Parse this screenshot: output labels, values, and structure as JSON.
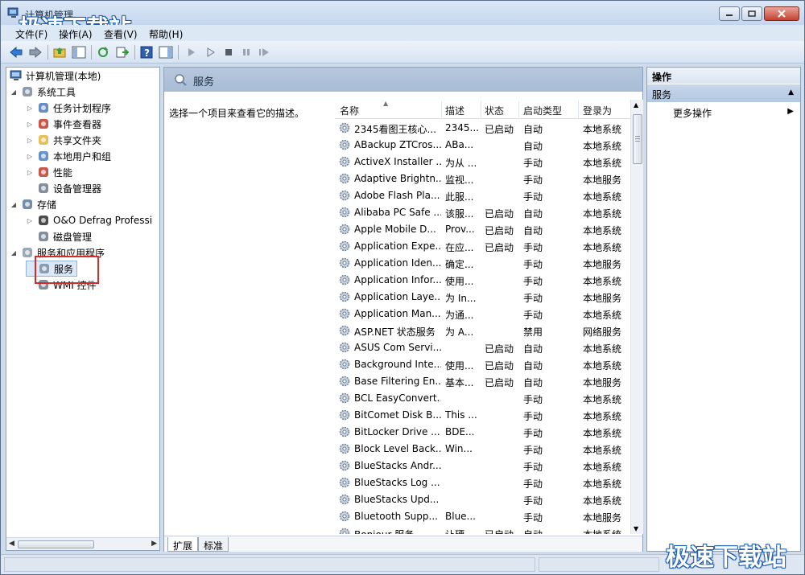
{
  "window": {
    "title": "计算机管理",
    "watermark": "极速下载站"
  },
  "menu": [
    "文件(F)",
    "操作(A)",
    "查看(V)",
    "帮助(H)"
  ],
  "tree": {
    "root": "计算机管理(本地)",
    "items": [
      {
        "label": "系统工具",
        "level": 1,
        "expander": "◢",
        "icon": "tools-icon"
      },
      {
        "label": "任务计划程序",
        "level": 2,
        "expander": "▷",
        "icon": "clock-icon"
      },
      {
        "label": "事件查看器",
        "level": 2,
        "expander": "▷",
        "icon": "event-viewer-icon"
      },
      {
        "label": "共享文件夹",
        "level": 2,
        "expander": "▷",
        "icon": "shared-folder-icon"
      },
      {
        "label": "本地用户和组",
        "level": 2,
        "expander": "▷",
        "icon": "users-icon"
      },
      {
        "label": "性能",
        "level": 2,
        "expander": "▷",
        "icon": "performance-icon"
      },
      {
        "label": "设备管理器",
        "level": 2,
        "expander": "",
        "icon": "device-manager-icon"
      },
      {
        "label": "存储",
        "level": 1,
        "expander": "◢",
        "icon": "storage-icon"
      },
      {
        "label": "O&O Defrag Professi",
        "level": 2,
        "expander": "▷",
        "icon": "defrag-icon"
      },
      {
        "label": "磁盘管理",
        "level": 2,
        "expander": "",
        "icon": "disk-icon"
      },
      {
        "label": "服务和应用程序",
        "level": 1,
        "expander": "◢",
        "icon": "services-apps-icon"
      },
      {
        "label": "服务",
        "level": 2,
        "expander": "",
        "icon": "services-icon",
        "selected": true
      },
      {
        "label": "WMI 控件",
        "level": 2,
        "expander": "",
        "icon": "wmi-icon"
      }
    ]
  },
  "center": {
    "header_title": "服务",
    "description": "选择一个项目来查看它的描述。",
    "columns": [
      "名称",
      "描述",
      "状态",
      "启动类型",
      "登录为"
    ],
    "rows": [
      [
        "2345看图王核心...",
        "2345...",
        "已启动",
        "自动",
        "本地系统"
      ],
      [
        "ABackup ZTCros...",
        "ABa...",
        "",
        "自动",
        "本地系统"
      ],
      [
        "ActiveX Installer ...",
        "为从 ...",
        "",
        "手动",
        "本地系统"
      ],
      [
        "Adaptive Brightn...",
        "监视...",
        "",
        "手动",
        "本地服务"
      ],
      [
        "Adobe Flash Pla...",
        "此服...",
        "",
        "手动",
        "本地系统"
      ],
      [
        "Alibaba PC Safe ...",
        "该服...",
        "已启动",
        "自动",
        "本地系统"
      ],
      [
        "Apple Mobile D...",
        "Prov...",
        "已启动",
        "自动",
        "本地系统"
      ],
      [
        "Application Expe...",
        "在应...",
        "已启动",
        "手动",
        "本地系统"
      ],
      [
        "Application Iden...",
        "确定...",
        "",
        "手动",
        "本地服务"
      ],
      [
        "Application Infor...",
        "使用...",
        "",
        "手动",
        "本地系统"
      ],
      [
        "Application Laye...",
        "为 In...",
        "",
        "手动",
        "本地服务"
      ],
      [
        "Application Man...",
        "为通...",
        "",
        "手动",
        "本地系统"
      ],
      [
        "ASP.NET 状态服务",
        "为 A...",
        "",
        "禁用",
        "网络服务"
      ],
      [
        "ASUS Com Servi...",
        "",
        "已启动",
        "自动",
        "本地系统"
      ],
      [
        "Background Inte...",
        "使用...",
        "已启动",
        "自动",
        "本地系统"
      ],
      [
        "Base Filtering En...",
        "基本...",
        "已启动",
        "自动",
        "本地服务"
      ],
      [
        "BCL EasyConvert...",
        "",
        "",
        "手动",
        "本地系统"
      ],
      [
        "BitComet Disk B...",
        "This ...",
        "",
        "手动",
        "本地系统"
      ],
      [
        "BitLocker Drive ...",
        "BDE...",
        "",
        "手动",
        "本地系统"
      ],
      [
        "Block Level Back...",
        "Win...",
        "",
        "手动",
        "本地系统"
      ],
      [
        "BlueStacks Andr...",
        "",
        "",
        "手动",
        "本地系统"
      ],
      [
        "BlueStacks Log ...",
        "",
        "",
        "手动",
        "本地系统"
      ],
      [
        "BlueStacks Upd...",
        "",
        "",
        "手动",
        "本地系统"
      ],
      [
        "Bluetooth Supp...",
        "Blue...",
        "",
        "手动",
        "本地服务"
      ],
      [
        "Bonjour 服务",
        "让硬...",
        "已启动",
        "自动",
        "本地系统"
      ]
    ],
    "tabs": [
      "扩展",
      "标准"
    ]
  },
  "actions": {
    "title": "操作",
    "section": "服务",
    "item": "更多操作"
  }
}
